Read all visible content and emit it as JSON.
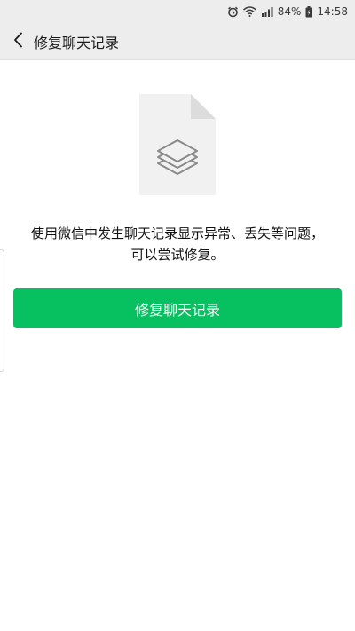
{
  "status_bar": {
    "battery": "84%",
    "time": "14:58",
    "icons": [
      "alarm-icon",
      "wifi-icon",
      "cellular-4g-icon",
      "battery-icon"
    ]
  },
  "nav": {
    "back_icon": "chevron-left-icon",
    "title": "修复聊天记录"
  },
  "main": {
    "illustration_icon": "document-layers-icon",
    "description": "使用微信中发生聊天记录显示异常、丢失等问题，可以尝试修复。",
    "repair_button_label": "修复聊天记录"
  },
  "colors": {
    "accent": "#07c160",
    "header_bg": "#ededed"
  }
}
